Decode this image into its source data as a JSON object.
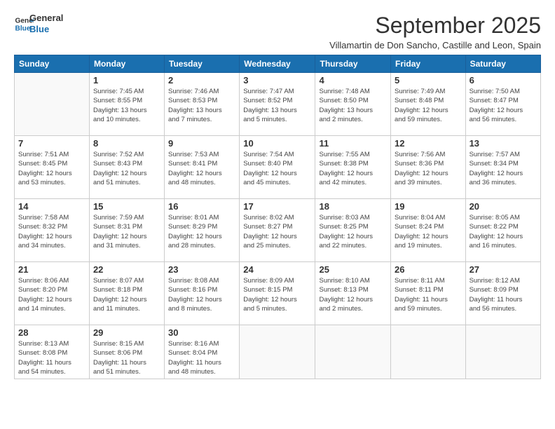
{
  "logo": {
    "line1": "General",
    "line2": "Blue"
  },
  "title": "September 2025",
  "subtitle": "Villamartin de Don Sancho, Castille and Leon, Spain",
  "days_of_week": [
    "Sunday",
    "Monday",
    "Tuesday",
    "Wednesday",
    "Thursday",
    "Friday",
    "Saturday"
  ],
  "weeks": [
    [
      {
        "day": "",
        "info": ""
      },
      {
        "day": "1",
        "info": "Sunrise: 7:45 AM\nSunset: 8:55 PM\nDaylight: 13 hours\nand 10 minutes."
      },
      {
        "day": "2",
        "info": "Sunrise: 7:46 AM\nSunset: 8:53 PM\nDaylight: 13 hours\nand 7 minutes."
      },
      {
        "day": "3",
        "info": "Sunrise: 7:47 AM\nSunset: 8:52 PM\nDaylight: 13 hours\nand 5 minutes."
      },
      {
        "day": "4",
        "info": "Sunrise: 7:48 AM\nSunset: 8:50 PM\nDaylight: 13 hours\nand 2 minutes."
      },
      {
        "day": "5",
        "info": "Sunrise: 7:49 AM\nSunset: 8:48 PM\nDaylight: 12 hours\nand 59 minutes."
      },
      {
        "day": "6",
        "info": "Sunrise: 7:50 AM\nSunset: 8:47 PM\nDaylight: 12 hours\nand 56 minutes."
      }
    ],
    [
      {
        "day": "7",
        "info": "Sunrise: 7:51 AM\nSunset: 8:45 PM\nDaylight: 12 hours\nand 53 minutes."
      },
      {
        "day": "8",
        "info": "Sunrise: 7:52 AM\nSunset: 8:43 PM\nDaylight: 12 hours\nand 51 minutes."
      },
      {
        "day": "9",
        "info": "Sunrise: 7:53 AM\nSunset: 8:41 PM\nDaylight: 12 hours\nand 48 minutes."
      },
      {
        "day": "10",
        "info": "Sunrise: 7:54 AM\nSunset: 8:40 PM\nDaylight: 12 hours\nand 45 minutes."
      },
      {
        "day": "11",
        "info": "Sunrise: 7:55 AM\nSunset: 8:38 PM\nDaylight: 12 hours\nand 42 minutes."
      },
      {
        "day": "12",
        "info": "Sunrise: 7:56 AM\nSunset: 8:36 PM\nDaylight: 12 hours\nand 39 minutes."
      },
      {
        "day": "13",
        "info": "Sunrise: 7:57 AM\nSunset: 8:34 PM\nDaylight: 12 hours\nand 36 minutes."
      }
    ],
    [
      {
        "day": "14",
        "info": "Sunrise: 7:58 AM\nSunset: 8:32 PM\nDaylight: 12 hours\nand 34 minutes."
      },
      {
        "day": "15",
        "info": "Sunrise: 7:59 AM\nSunset: 8:31 PM\nDaylight: 12 hours\nand 31 minutes."
      },
      {
        "day": "16",
        "info": "Sunrise: 8:01 AM\nSunset: 8:29 PM\nDaylight: 12 hours\nand 28 minutes."
      },
      {
        "day": "17",
        "info": "Sunrise: 8:02 AM\nSunset: 8:27 PM\nDaylight: 12 hours\nand 25 minutes."
      },
      {
        "day": "18",
        "info": "Sunrise: 8:03 AM\nSunset: 8:25 PM\nDaylight: 12 hours\nand 22 minutes."
      },
      {
        "day": "19",
        "info": "Sunrise: 8:04 AM\nSunset: 8:24 PM\nDaylight: 12 hours\nand 19 minutes."
      },
      {
        "day": "20",
        "info": "Sunrise: 8:05 AM\nSunset: 8:22 PM\nDaylight: 12 hours\nand 16 minutes."
      }
    ],
    [
      {
        "day": "21",
        "info": "Sunrise: 8:06 AM\nSunset: 8:20 PM\nDaylight: 12 hours\nand 14 minutes."
      },
      {
        "day": "22",
        "info": "Sunrise: 8:07 AM\nSunset: 8:18 PM\nDaylight: 12 hours\nand 11 minutes."
      },
      {
        "day": "23",
        "info": "Sunrise: 8:08 AM\nSunset: 8:16 PM\nDaylight: 12 hours\nand 8 minutes."
      },
      {
        "day": "24",
        "info": "Sunrise: 8:09 AM\nSunset: 8:15 PM\nDaylight: 12 hours\nand 5 minutes."
      },
      {
        "day": "25",
        "info": "Sunrise: 8:10 AM\nSunset: 8:13 PM\nDaylight: 12 hours\nand 2 minutes."
      },
      {
        "day": "26",
        "info": "Sunrise: 8:11 AM\nSunset: 8:11 PM\nDaylight: 11 hours\nand 59 minutes."
      },
      {
        "day": "27",
        "info": "Sunrise: 8:12 AM\nSunset: 8:09 PM\nDaylight: 11 hours\nand 56 minutes."
      }
    ],
    [
      {
        "day": "28",
        "info": "Sunrise: 8:13 AM\nSunset: 8:08 PM\nDaylight: 11 hours\nand 54 minutes."
      },
      {
        "day": "29",
        "info": "Sunrise: 8:15 AM\nSunset: 8:06 PM\nDaylight: 11 hours\nand 51 minutes."
      },
      {
        "day": "30",
        "info": "Sunrise: 8:16 AM\nSunset: 8:04 PM\nDaylight: 11 hours\nand 48 minutes."
      },
      {
        "day": "",
        "info": ""
      },
      {
        "day": "",
        "info": ""
      },
      {
        "day": "",
        "info": ""
      },
      {
        "day": "",
        "info": ""
      }
    ]
  ]
}
